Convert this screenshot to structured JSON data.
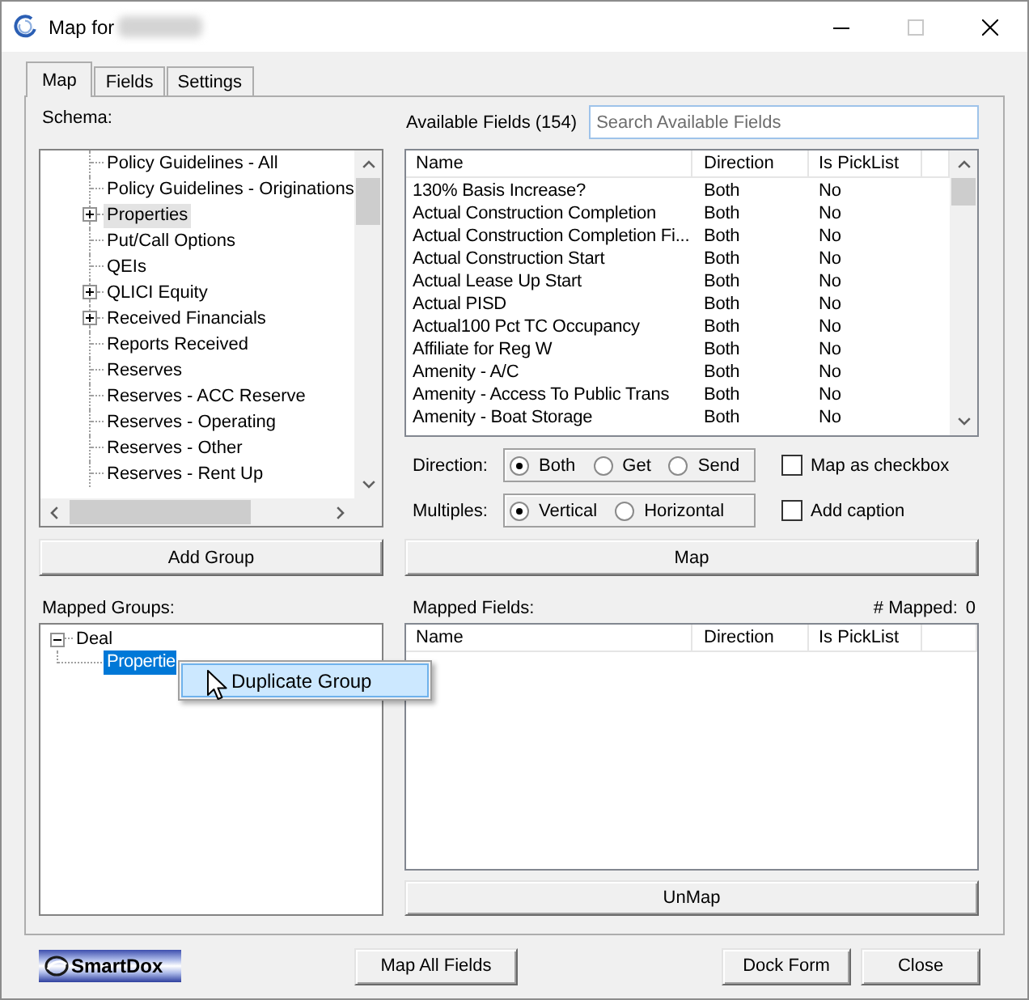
{
  "window": {
    "title": "Map for",
    "maximize_disabled": true
  },
  "tabs": [
    {
      "label": "Map",
      "selected": true
    },
    {
      "label": "Fields",
      "selected": false
    },
    {
      "label": "Settings",
      "selected": false
    }
  ],
  "schema": {
    "label": "Schema:",
    "items": [
      {
        "label": "Policy Guidelines - All",
        "has_children": false,
        "selected": false
      },
      {
        "label": "Policy Guidelines - Originations",
        "has_children": false,
        "selected": false
      },
      {
        "label": "Properties",
        "has_children": true,
        "selected": true
      },
      {
        "label": "Put/Call Options",
        "has_children": false,
        "selected": false
      },
      {
        "label": "QEIs",
        "has_children": false,
        "selected": false
      },
      {
        "label": "QLICI Equity",
        "has_children": true,
        "selected": false
      },
      {
        "label": "Received Financials",
        "has_children": true,
        "selected": false
      },
      {
        "label": "Reports Received",
        "has_children": false,
        "selected": false
      },
      {
        "label": "Reserves",
        "has_children": false,
        "selected": false
      },
      {
        "label": "Reserves - ACC Reserve",
        "has_children": false,
        "selected": false
      },
      {
        "label": "Reserves - Operating",
        "has_children": false,
        "selected": false
      },
      {
        "label": "Reserves - Other",
        "has_children": false,
        "selected": false
      },
      {
        "label": "Reserves - Rent Up",
        "has_children": false,
        "selected": false
      }
    ]
  },
  "available_fields": {
    "label": "Available Fields (154)",
    "search": {
      "placeholder": "Search Available Fields"
    },
    "columns": [
      "Name",
      "Direction",
      "Is PickList"
    ],
    "rows": [
      [
        "130% Basis Increase?",
        "Both",
        "No"
      ],
      [
        "Actual Construction Completion",
        "Both",
        "No"
      ],
      [
        "Actual Construction Completion Fi...",
        "Both",
        "No"
      ],
      [
        "Actual Construction Start",
        "Both",
        "No"
      ],
      [
        "Actual Lease Up Start",
        "Both",
        "No"
      ],
      [
        "Actual PISD",
        "Both",
        "No"
      ],
      [
        "Actual100 Pct TC Occupancy",
        "Both",
        "No"
      ],
      [
        "Affiliate for Reg W",
        "Both",
        "No"
      ],
      [
        "Amenity - A/C",
        "Both",
        "No"
      ],
      [
        "Amenity - Access To Public Trans",
        "Both",
        "No"
      ],
      [
        "Amenity - Boat Storage",
        "Both",
        "No"
      ]
    ]
  },
  "options": [
    {
      "label": "Direction:",
      "choices": [
        {
          "label": "Both",
          "selected": true
        },
        {
          "label": "Get",
          "selected": false
        },
        {
          "label": "Send",
          "selected": false
        }
      ],
      "checkbox": {
        "label": "Map as checkbox",
        "checked": false
      }
    },
    {
      "label": "Multiples:",
      "choices": [
        {
          "label": "Vertical",
          "selected": true
        },
        {
          "label": "Horizontal",
          "selected": false
        }
      ],
      "checkbox": {
        "label": "Add caption",
        "checked": false
      }
    }
  ],
  "add_group_button": "Add Group",
  "map_button": "Map",
  "mapped_groups": {
    "label": "Mapped Groups:",
    "tree": [
      {
        "label": "Deal",
        "expanded": true,
        "selected": false,
        "children": [
          {
            "label": "Propertie",
            "selected": true
          }
        ]
      }
    ]
  },
  "context_menu": {
    "items": [
      {
        "label": "Duplicate Group",
        "selected": true
      }
    ]
  },
  "mapped_fields": {
    "label": "Mapped Fields:",
    "count_label": "# Mapped:",
    "count": "0",
    "columns": [
      "Name",
      "Direction",
      "Is PickList"
    ]
  },
  "unmap_button": "UnMap",
  "footer": {
    "logo": "SmartDox",
    "buttons": [
      "Map All Fields",
      "Dock Form",
      "Close"
    ]
  }
}
